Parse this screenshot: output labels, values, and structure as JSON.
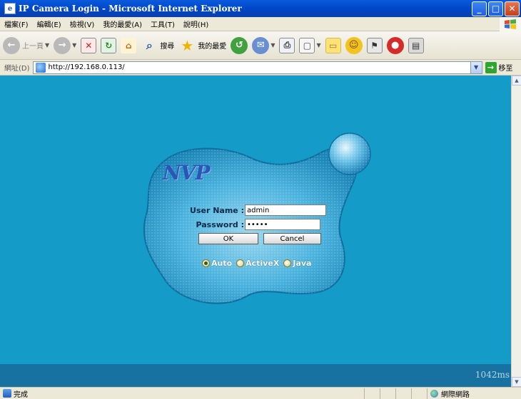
{
  "window": {
    "title": "IP Camera Login - Microsoft Internet Explorer",
    "minimize": "_",
    "maximize": "□",
    "close": "✕"
  },
  "menu": {
    "items": [
      "檔案(F)",
      "編輯(E)",
      "檢視(V)",
      "我的最愛(A)",
      "工具(T)",
      "說明(H)"
    ]
  },
  "toolbar": {
    "back_label": "上一頁",
    "search_label": "搜尋",
    "favorites_label": "我的最愛"
  },
  "address": {
    "label": "網址(D)",
    "url": "http://192.168.0.113/",
    "go_label": "移至"
  },
  "page": {
    "logo": "NVP",
    "username_label": "User Name :",
    "username_value": "admin",
    "password_label": "Password :",
    "password_value": "admin",
    "ok_label": "OK",
    "cancel_label": "Cancel",
    "mode_options": [
      "Auto",
      "ActiveX",
      "Java"
    ],
    "selected_mode": "Auto",
    "timer": "1042ms",
    "background_color": "#149bc8"
  },
  "status": {
    "text": "完成",
    "zone": "網際網路"
  }
}
